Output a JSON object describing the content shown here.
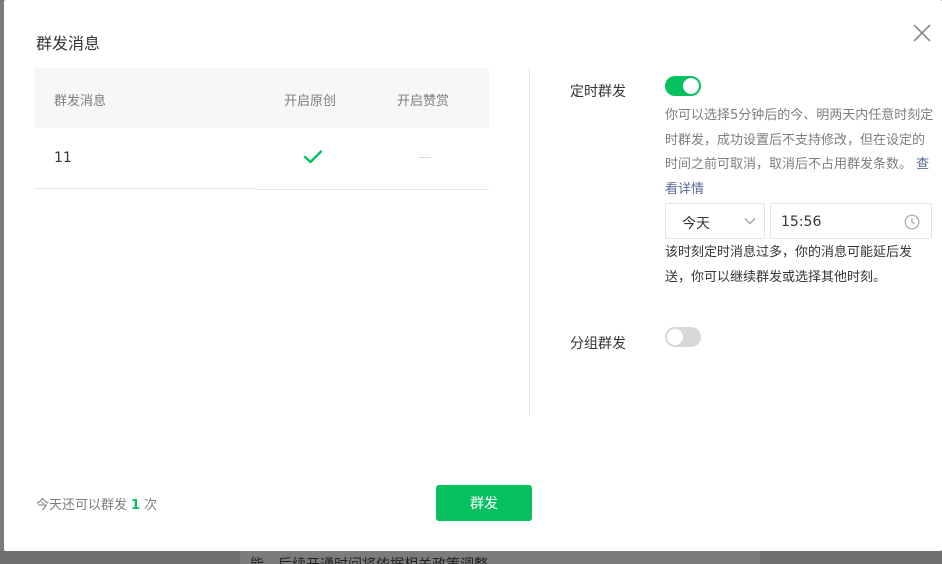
{
  "dialog": {
    "title": "群发消息",
    "close_icon": "close-icon"
  },
  "table": {
    "headers": {
      "message": "群发消息",
      "original": "开启原创",
      "reward": "开启赞赏"
    },
    "rows": [
      {
        "message": "11",
        "original_icon": "checkmark-icon",
        "original_color": "#07c160",
        "reward": "disabled-dash"
      }
    ]
  },
  "settings": {
    "timed": {
      "label": "定时群发",
      "enabled": true,
      "description": "你可以选择5分钟后的今、明两天内任意时刻定时群发，成功设置后不支持修改，但在设定的时间之前可取消，取消后不占用群发条数。",
      "detail_link": "查看详情",
      "day_select": "今天",
      "time_value": "15:56",
      "warning": "该时刻定时消息过多，你的消息可能延后发送，你可以继续群发或选择其他时刻。"
    },
    "group": {
      "label": "分组群发",
      "enabled": false
    }
  },
  "footer": {
    "quota_prefix": "今天还可以群发",
    "quota_count": "1",
    "quota_suffix": "次",
    "send_label": "群发"
  },
  "backdrop": {
    "peek_text": "能，后续开通时间将依据相关政策调整"
  },
  "colors": {
    "accent": "#07c160",
    "link": "#576b95"
  }
}
